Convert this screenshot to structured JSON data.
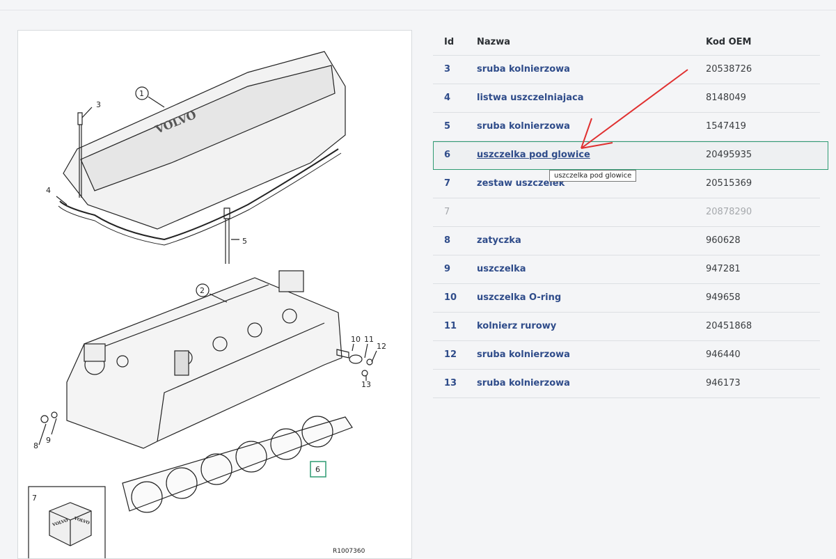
{
  "table": {
    "headers": {
      "id": "Id",
      "name": "Nazwa",
      "code": "Kod OEM"
    },
    "rows": [
      {
        "id": "3",
        "name": "sruba kolnierzowa",
        "code": "20538726"
      },
      {
        "id": "4",
        "name": "listwa uszczelniajaca",
        "code": "8148049"
      },
      {
        "id": "5",
        "name": "sruba kolnierzowa",
        "code": "1547419"
      },
      {
        "id": "6",
        "name": "uszczelka pod glowice",
        "code": "20495935"
      },
      {
        "id": "7",
        "name": "zestaw uszczelek",
        "code": "20515369"
      },
      {
        "id": "7",
        "name": "",
        "code": "20878290"
      },
      {
        "id": "8",
        "name": "zatyczka",
        "code": "960628"
      },
      {
        "id": "9",
        "name": "uszczelka",
        "code": "947281"
      },
      {
        "id": "10",
        "name": "uszczelka O-ring",
        "code": "949658"
      },
      {
        "id": "11",
        "name": "kolnierz rurowy",
        "code": "20451868"
      },
      {
        "id": "12",
        "name": "sruba kolnierzowa",
        "code": "946440"
      },
      {
        "id": "13",
        "name": "sruba kolnierzowa",
        "code": "946173"
      }
    ],
    "selected_id": "6"
  },
  "tooltip": {
    "text": "uszczelka pod glowice"
  },
  "diagram": {
    "callouts": [
      "1",
      "2",
      "3",
      "4",
      "5",
      "6",
      "7",
      "8",
      "9",
      "10",
      "11",
      "12",
      "13"
    ],
    "brand_text": "VOLVO",
    "kit_brand_a": "VOLVO",
    "kit_brand_b": "VOLVO",
    "drawing_code": "R1007360"
  },
  "colors": {
    "link": "#2f4c8a",
    "selected_outline": "#2e9b72",
    "annotation_arrow": "#e03030"
  }
}
